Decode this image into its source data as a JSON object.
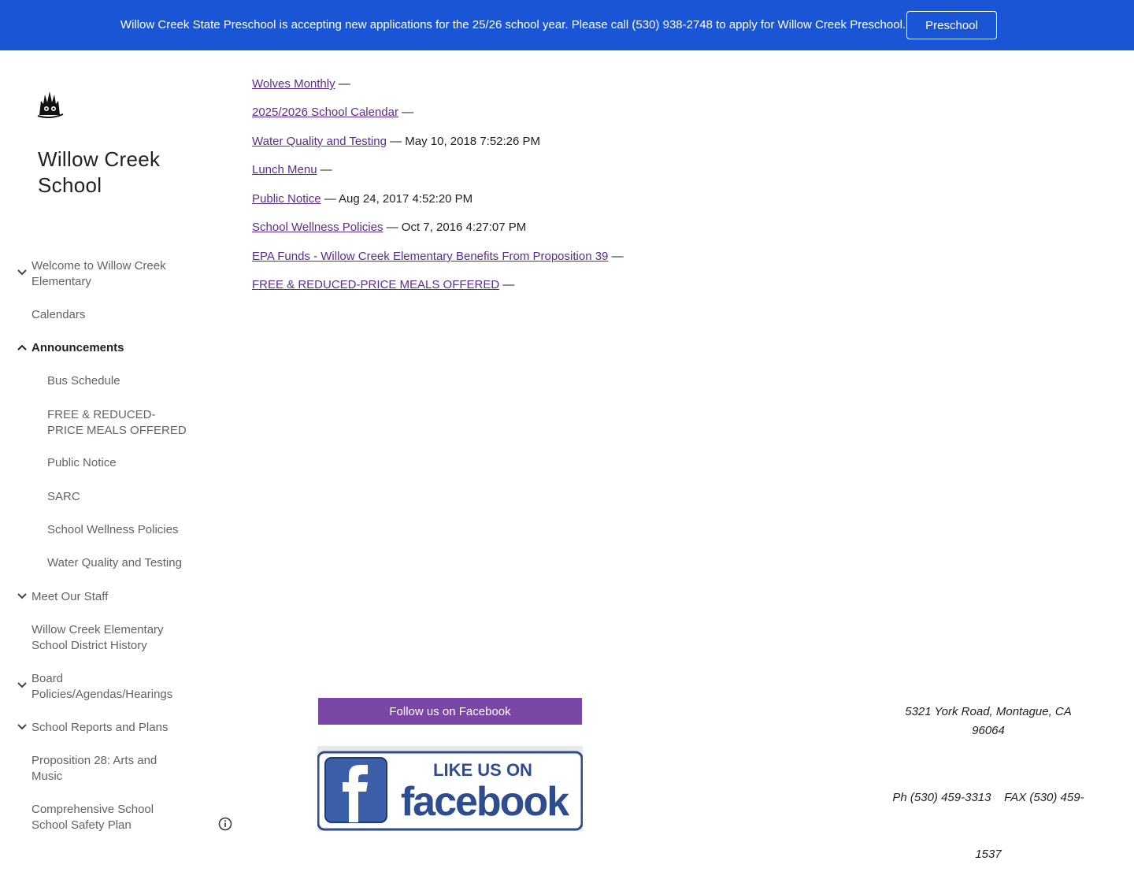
{
  "banner": {
    "text": "Willow Creek State Preschool is accepting new applications for the 25/26 school year. Please call (530) 938-2748 to apply for Willow Creek Preschool.",
    "button_label": "Preschool"
  },
  "site": {
    "title_line1": "Willow Creek",
    "title_line2": "School"
  },
  "sidebar": {
    "items": [
      {
        "line1": "Welcome to Willow Creek",
        "line2": "Elementary"
      },
      {
        "line1": "Calendars"
      },
      {
        "line1": "Announcements"
      },
      {
        "line1": "Bus Schedule"
      },
      {
        "line1": "FREE & REDUCED-",
        "line2": "PRICE MEALS OFFERED"
      },
      {
        "line1": "Public Notice"
      },
      {
        "line1": "SARC"
      },
      {
        "line1": "School Wellness Policies"
      },
      {
        "line1": "Water Quality and Testing"
      },
      {
        "line1": "Meet Our Staff"
      },
      {
        "line1": "Willow Creek Elementary",
        "line2": "School District History"
      },
      {
        "line1": "Board",
        "line2": "Policies/Agendas/Hearings"
      },
      {
        "line1": "School Reports and Plans"
      },
      {
        "line1": "Proposition 28: Arts and",
        "line2": "Music"
      },
      {
        "line1": "Comprehensive School",
        "line2": "School Safety Plan"
      }
    ]
  },
  "announcements": [
    {
      "link": "Wolves Monthly",
      "suffix": " —"
    },
    {
      "link": "2025/2026 School Calendar",
      "suffix": " —"
    },
    {
      "link": "Water Quality and Testing",
      "suffix": " — May 10, 2018 7:52:26 PM"
    },
    {
      "link": "Lunch Menu",
      "suffix": " —"
    },
    {
      "link": "Public Notice",
      "suffix": " — Aug 24, 2017 4:52:20 PM"
    },
    {
      "link": "School Wellness Policies",
      "suffix": " — Oct 7, 2016 4:27:07 PM"
    },
    {
      "link": "EPA Funds - Willow Creek Elementary Benefits From Proposition 39",
      "suffix": " —"
    },
    {
      "link": "FREE & REDUCED-PRICE MEALS OFFERED",
      "suffix": " —"
    }
  ],
  "footer": {
    "facebook_button": "Follow us on Facebook",
    "fb_image_top": "LIKE US ON",
    "fb_image_brand": "facebook",
    "address_line1": "5321 York Road, Montague, CA",
    "address_line2": "96064",
    "phone_line1": "Ph (530) 459-3313    FAX (530) 459-",
    "phone_line2": "1537"
  },
  "colors": {
    "banner": "#1a55d6",
    "link": "#5b2c91",
    "facebook_button": "#7a47a6"
  }
}
